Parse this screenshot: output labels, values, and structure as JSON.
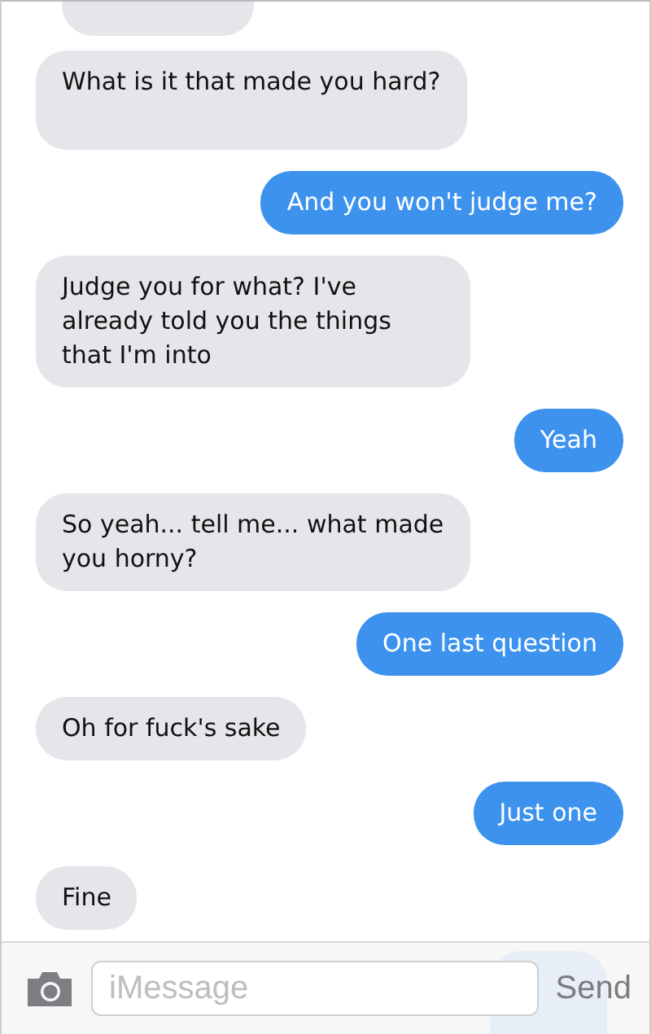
{
  "messages": [
    {
      "kind": "received",
      "text": "What is it that made you hard?"
    },
    {
      "kind": "sent",
      "text": "And you won't judge me?"
    },
    {
      "kind": "received",
      "text": "Judge you for what? I've already told you the things that I'm into"
    },
    {
      "kind": "sent",
      "text": "Yeah"
    },
    {
      "kind": "received",
      "text": "So yeah... tell me... what made you horny?"
    },
    {
      "kind": "sent",
      "text": "One last question"
    },
    {
      "kind": "received",
      "text": "Oh for fuck's sake"
    },
    {
      "kind": "sent",
      "text": "Just one"
    },
    {
      "kind": "received",
      "text": "Fine"
    }
  ],
  "composer": {
    "placeholder": "iMessage",
    "send": "Send"
  }
}
